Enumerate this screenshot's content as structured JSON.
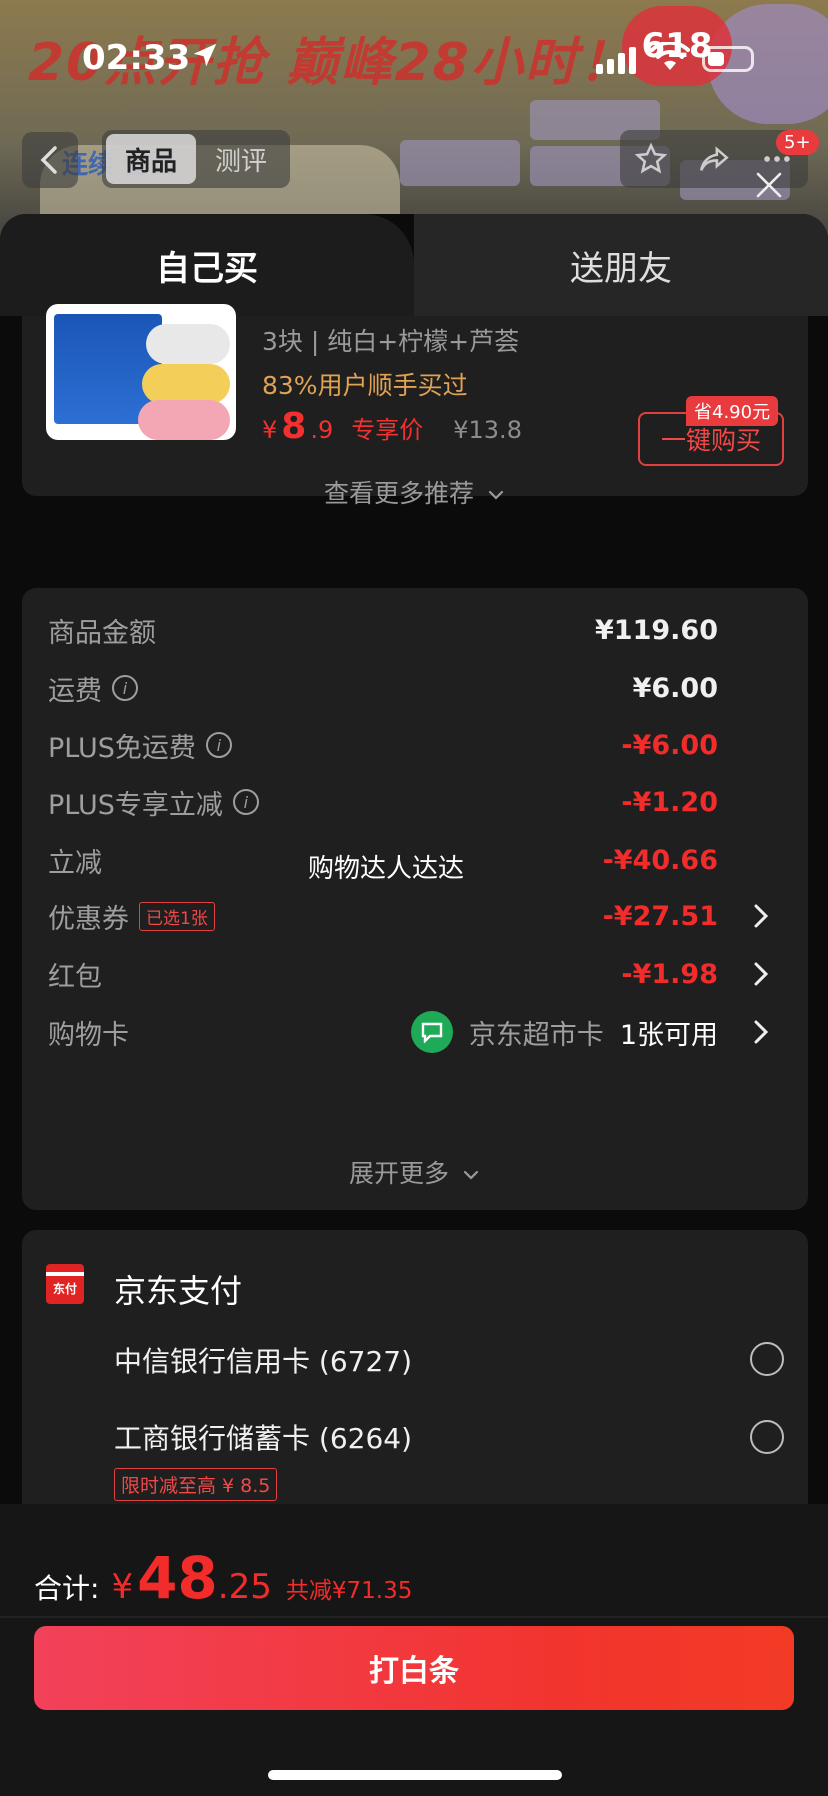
{
  "status_bar": {
    "time": "02:33"
  },
  "banner": {
    "promo": "20点开抢 巅峰28小时！",
    "tag": "618",
    "side_text": "连续 全国"
  },
  "nav": {
    "tabs": [
      "商品",
      "测评"
    ],
    "badge": "5+"
  },
  "sheet": {
    "tabs": {
      "self": "自己买",
      "friend": "送朋友"
    }
  },
  "recommend": {
    "spec": "3块 | 纯白+柠檬+芦荟",
    "rate": "83%用户顺手买过",
    "price_currency": "¥",
    "price_int": "8",
    "price_dec": ".9",
    "price_tag": "专享价",
    "original_price": "¥13.8",
    "save_badge": "省4.90元",
    "buy_button": "一键购买",
    "more": "查看更多推荐"
  },
  "costs": {
    "rows": [
      {
        "label": "商品金额",
        "value": "¥119.60",
        "color": "white"
      },
      {
        "label": "运费",
        "value": "¥6.00",
        "color": "white"
      },
      {
        "label": "PLUS免运费",
        "value": "-¥6.00",
        "color": "red"
      },
      {
        "label": "PLUS专享立减",
        "value": "-¥1.20",
        "color": "red"
      },
      {
        "label": "立减",
        "value": "-¥40.66",
        "color": "red"
      },
      {
        "label": "优惠券",
        "value": "-¥27.51",
        "color": "red",
        "tag": "已选1张"
      },
      {
        "label": "红包",
        "value": "-¥1.98",
        "color": "red"
      },
      {
        "label": "购物卡",
        "card_name": "京东超市卡",
        "card_avail": "1张可用"
      }
    ],
    "expand": "展开更多",
    "overlay": "购物达人达达"
  },
  "payment": {
    "logo_text": "东付",
    "title": "京东支付",
    "options": [
      {
        "label": "中信银行信用卡 (6727)"
      },
      {
        "label": "工商银行储蓄卡 (6264)"
      }
    ],
    "promo": "限时减至高 ¥ 8.5"
  },
  "footer": {
    "total_label": "合计:",
    "currency": "¥",
    "total_int": "48",
    "total_dec": ".25",
    "save": "共减¥71.35",
    "pay_button": "打白条"
  }
}
